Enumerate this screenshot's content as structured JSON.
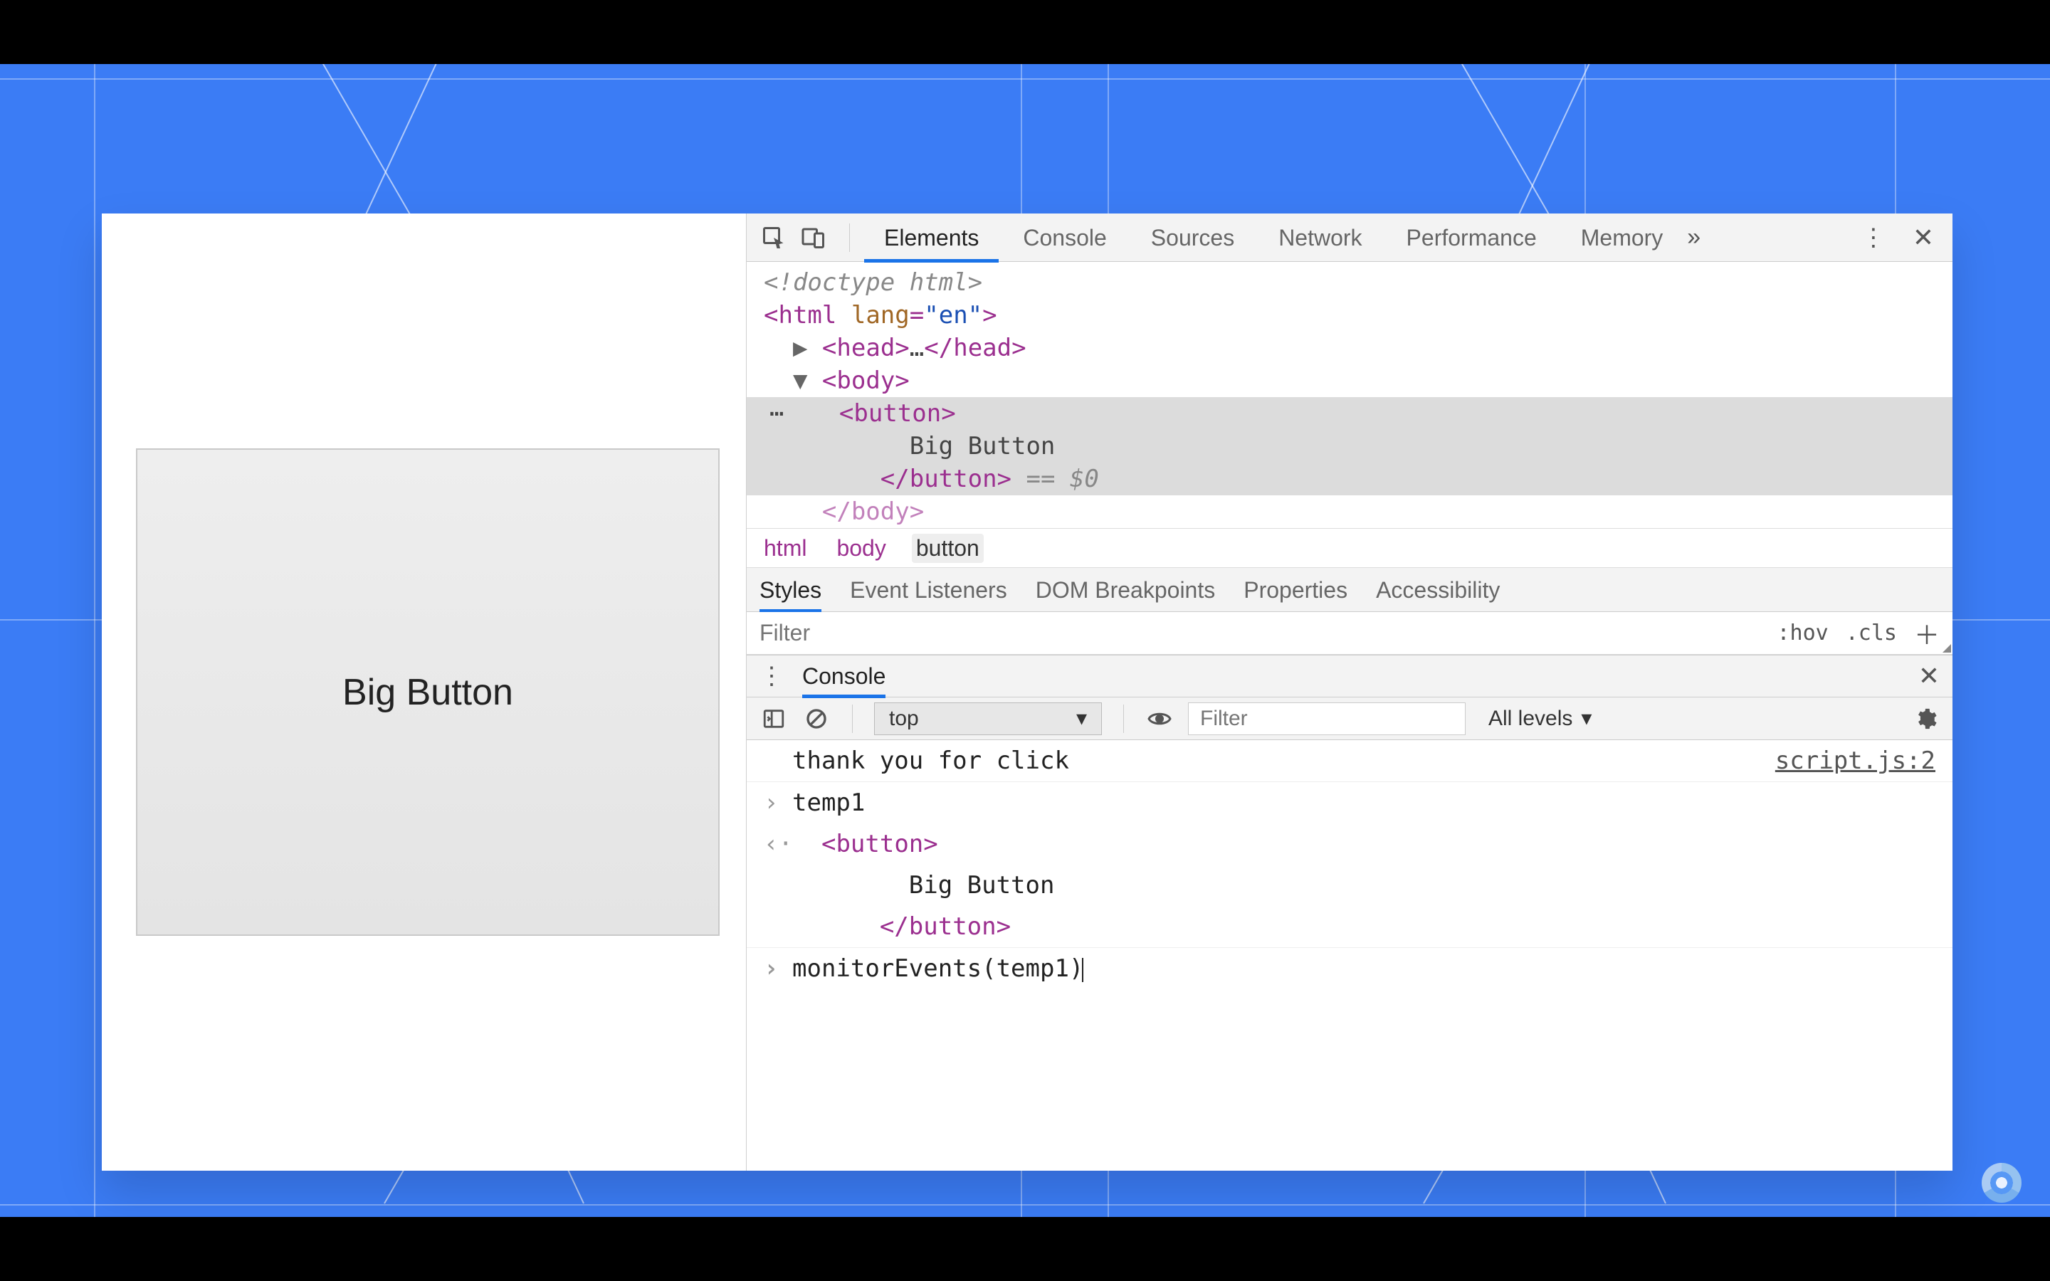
{
  "page": {
    "big_button_label": "Big Button"
  },
  "devtools": {
    "tabs": [
      "Elements",
      "Console",
      "Sources",
      "Network",
      "Performance",
      "Memory"
    ],
    "active_tab": "Elements",
    "dom": {
      "doctype": "<!doctype html>",
      "html_open_tag": "html",
      "html_attr_name": "lang",
      "html_attr_value": "en",
      "head_open": "head",
      "head_dots": "…",
      "head_close": "head",
      "body_open": "body",
      "button_open": "button",
      "button_text": "Big Button",
      "button_close": "button",
      "eq0": " == $0",
      "body_close_partial": "</body>"
    },
    "breadcrumbs": [
      "html",
      "body",
      "button"
    ],
    "subtabs": [
      "Styles",
      "Event Listeners",
      "DOM Breakpoints",
      "Properties",
      "Accessibility"
    ],
    "active_subtab": "Styles",
    "filter_placeholder": "Filter",
    "hov": ":hov",
    "cls": ".cls"
  },
  "console": {
    "drawer_title": "Console",
    "context": "top",
    "filter_placeholder": "Filter",
    "levels": "All levels",
    "log_message": "thank you for click",
    "log_source": "script.js:2",
    "cmd1": "temp1",
    "echo_open": "button",
    "echo_text": "Big Button",
    "echo_close": "button",
    "cmd2": "monitorEvents(temp1)"
  }
}
